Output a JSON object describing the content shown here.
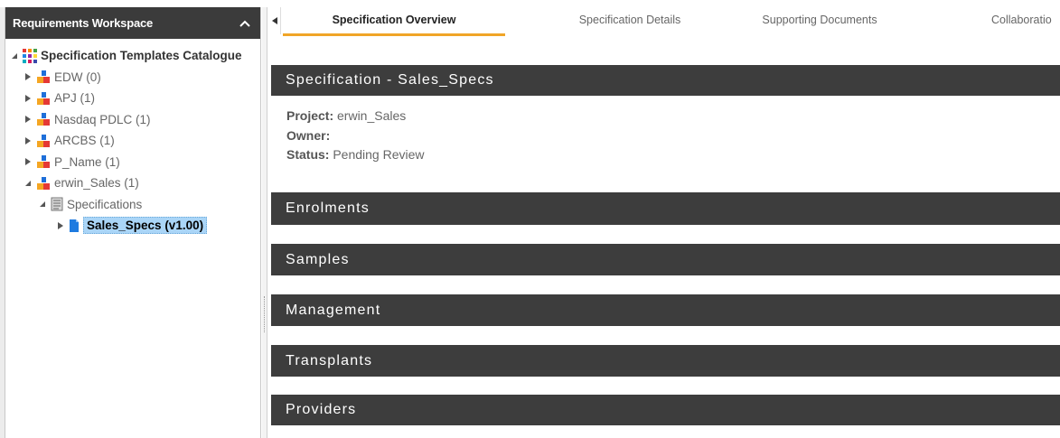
{
  "sidebar": {
    "title": "Requirements Workspace",
    "root_label": "Specification Templates Catalogue",
    "projects": [
      {
        "label": "EDW (0)"
      },
      {
        "label": "APJ (1)"
      },
      {
        "label": "Nasdaq PDLC (1)"
      },
      {
        "label": "ARCBS (1)"
      },
      {
        "label": "P_Name (1)"
      },
      {
        "label": "erwin_Sales (1)"
      }
    ],
    "folder_label": "Specifications",
    "selected_label": "Sales_Specs (v1.00)"
  },
  "tabs": [
    {
      "label": "Specification Overview"
    },
    {
      "label": "Specification Details"
    },
    {
      "label": "Supporting Documents"
    },
    {
      "label": "Collaboratio"
    }
  ],
  "spec": {
    "header": "Specification - Sales_Specs",
    "project_key": "Project:",
    "project_value": "erwin_Sales",
    "owner_key": "Owner:",
    "owner_value": "",
    "status_key": "Status:",
    "status_value": "Pending Review"
  },
  "sections": [
    {
      "label": "Enrolments"
    },
    {
      "label": "Samples"
    },
    {
      "label": "Management"
    },
    {
      "label": "Transplants"
    },
    {
      "label": "Providers"
    }
  ],
  "colors": {
    "header_bg": "#3b3b3b",
    "active_tab_underline": "#f0a527",
    "selection_bg": "#aad5f7",
    "section_bar_bg": "#3d3d3d"
  },
  "icons": {
    "catalogue": "grid-color-icon",
    "project": "project-blocks-icon",
    "folder": "document-folder-icon",
    "spec": "spec-file-icon"
  }
}
